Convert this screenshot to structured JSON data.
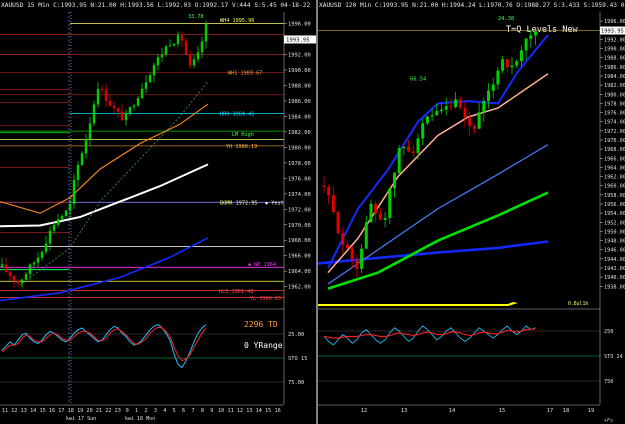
{
  "colors": {
    "background": "#000000",
    "up_candle": "#00d000",
    "down_candle": "#e00000",
    "ma_white": "#ffffff",
    "ma_blue": "#1428ff",
    "ma_orange": "#ff8a1e",
    "ma_salmon": "#ffb090",
    "ma_green": "#00e000",
    "ma_cornflower": "#4a7cff",
    "level_yellow": "#ffff60",
    "level_cyan": "#00e0ff",
    "level_magenta": "#ff30ff",
    "level_red": "#ff4040"
  },
  "left_chart": {
    "header": "XAUUSD 15 Min  C:1993.95 N:21.00 H:1993.56 L:1992.03 O:1992.17 V:444 S:5.45 04-18-22 ",
    "price_box": "1993.95",
    "price_axis": [
      "1996.00",
      "1994.00",
      "1992.00",
      "1990.00",
      "1988.00",
      "1986.00",
      "1984.00",
      "1982.00",
      "1980.00",
      "1978.00",
      "1976.00",
      "1974.00",
      "1972.00",
      "1970.00",
      "1968.00",
      "1966.00",
      "1964.00",
      "1962.00"
    ],
    "level_labels": {
      "wh4": "WH4  1995.96",
      "wh1": "WH1  1989.67",
      "hr0": "HR0  1984.41",
      "lm_high": "LM High",
      "yh": "YH  1980.19",
      "bomr": "BOMR 1972.95",
      "yest": "◆ Yest",
      "wp": "◆ WP 1964",
      "hl3": "HL3  1961.48",
      "yl": "YL  1960.65",
      "peak": "33.78"
    },
    "osc_axis": [
      "25.00",
      "STO 15",
      "75.00"
    ],
    "osc_labels": {
      "value": "2296 TD",
      "range": "0 YRange"
    },
    "time_axis": [
      "11",
      "12",
      "13",
      "14",
      "15",
      "16",
      "17",
      "18",
      "19",
      "20",
      "21",
      "22",
      "23",
      "0",
      "1",
      "2",
      "3",
      "4",
      "5",
      "6",
      "7",
      "8",
      "9",
      "10",
      "11",
      "12",
      "13",
      "14",
      "15",
      "16"
    ],
    "day_labels": [
      "kwi 17 Sun",
      "kwi 18 Mon"
    ]
  },
  "right_chart": {
    "header": "XAUUSD 120 Min  C:1993.95 N:21.00 H:1994.24 L:1970.76 O:1988.27 S:3.433 S:1959.43 04-18-22 0:49:00",
    "title": "T=Q Levels New",
    "price_box": "1993.95",
    "price_axis": [
      "1996.00",
      "1994.00",
      "1992.00",
      "1990.00",
      "1988.00",
      "1986.00",
      "1984.00",
      "1982.00",
      "1980.00",
      "1978.00",
      "1976.00",
      "1974.00",
      "1972.00",
      "1970.00",
      "1968.00",
      "1966.00",
      "1964.00",
      "1962.00",
      "1960.00",
      "1958.00",
      "1956.00",
      "1954.00",
      "1952.00",
      "1950.00",
      "1948.00",
      "1946.00",
      "1944.00",
      "1942.00",
      "1940.00",
      "1938.00"
    ],
    "candle_labels": {
      "top": "24.30",
      "mid": "66.54"
    },
    "strip_label": "0.8ul1h",
    "osc_axis": [
      "250",
      "STO 24",
      "750"
    ],
    "time_axis": [
      "12",
      "13",
      "14",
      "15",
      "17",
      "18",
      "19"
    ],
    "corner_label": "+Fs"
  }
}
